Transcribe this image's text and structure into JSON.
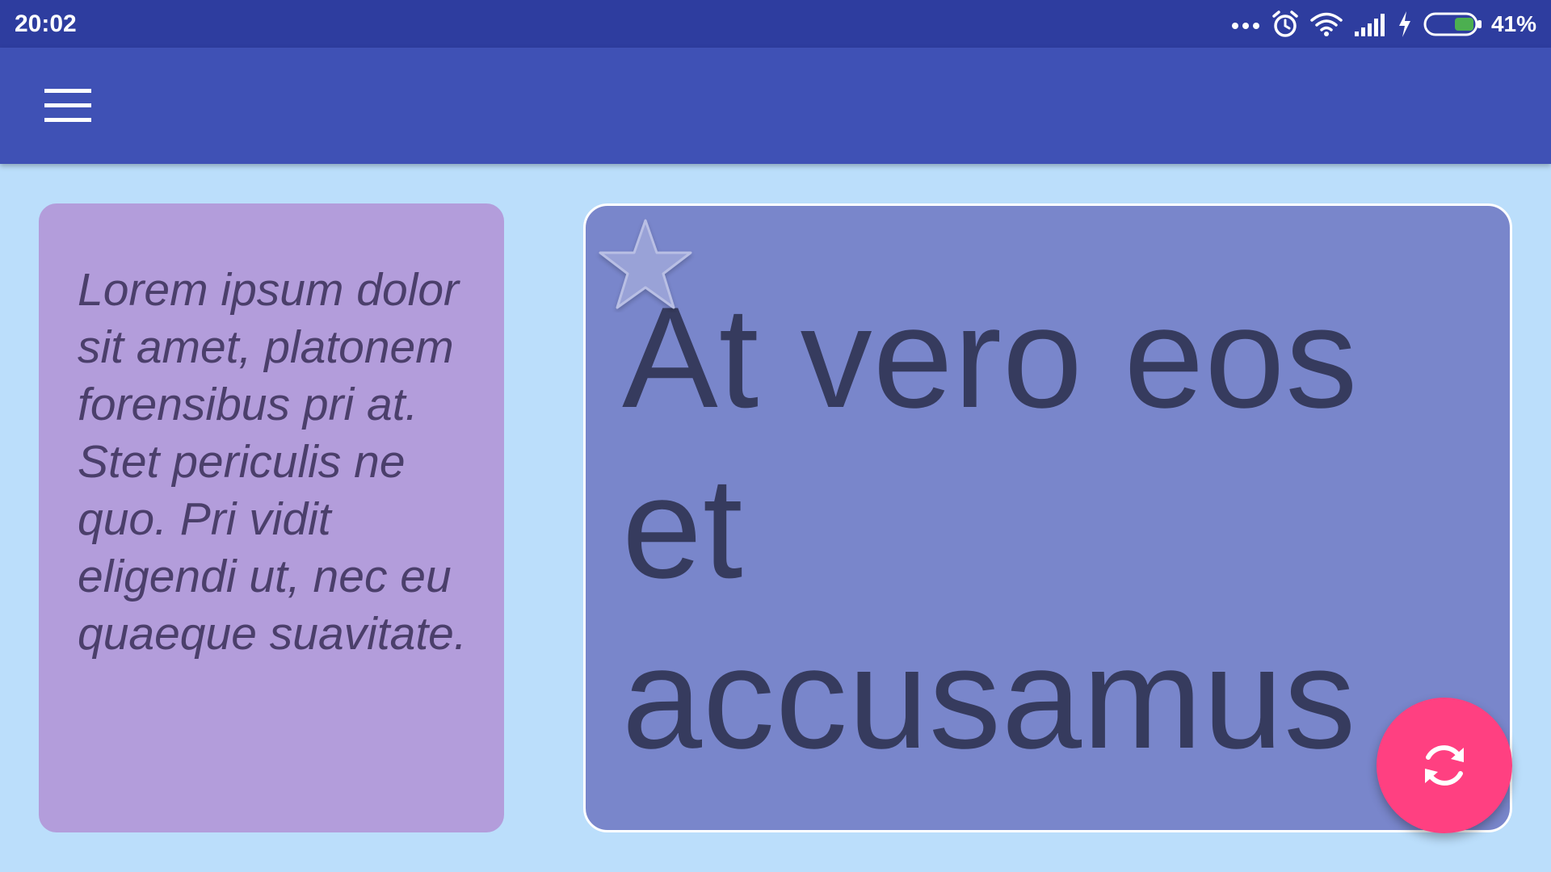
{
  "status_bar": {
    "time": "20:02",
    "battery_percent": "41%",
    "battery_level": 0.41,
    "icons": [
      "more-dots-icon",
      "alarm-icon",
      "wifi-icon",
      "signal-icon",
      "charging-icon",
      "battery-icon"
    ]
  },
  "app_bar": {
    "menu_icon": "hamburger-menu-icon"
  },
  "cards": {
    "left": {
      "text": "Lorem ipsum dolor sit amet, platonem forensibus pri at. Stet periculis ne quo. Pri vidit eligendi ut, nec eu quaeque suavitate."
    },
    "right": {
      "text": "At vero eos et accusamus",
      "badge_icon": "star-icon"
    }
  },
  "fab": {
    "icon": "refresh-icon"
  },
  "colors": {
    "status_bar": "#2E3D9F",
    "app_bar": "#3F51B5",
    "background": "#BBDEFB",
    "card_left": "#B39DDB",
    "card_right": "#7986CB",
    "fab": "#FF4081",
    "battery_fill": "#4CAF50"
  }
}
